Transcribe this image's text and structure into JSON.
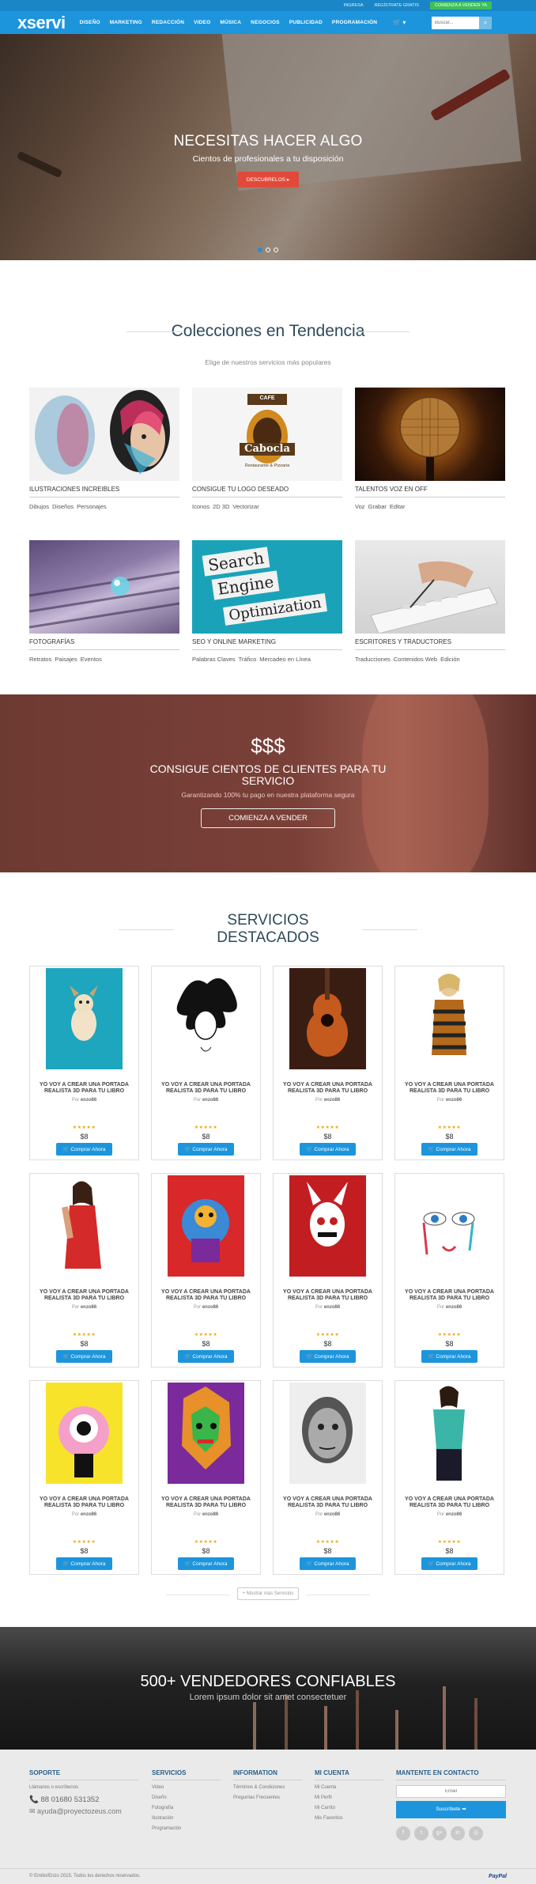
{
  "topbar": {
    "links": [
      "INGRESA",
      "REGÍSTRATE GRATIS"
    ],
    "sell": "COMIENZA A VENDER YA"
  },
  "nav": {
    "logo": "xservi",
    "links": [
      "DISEÑO",
      "MARKETING",
      "REDACCIÓN",
      "VIDEO",
      "MÚSICA",
      "NEGOCIOS",
      "PUBLICIDAD",
      "PROGRAMACIÓN"
    ],
    "cart": "🛒 ▾",
    "search_placeholder": "Buscar..."
  },
  "hero": {
    "title": "NECESITAS HACER ALGO",
    "subtitle": "Cientos de profesionales a tu disposición",
    "button": "DESCUBRELOS ▸"
  },
  "collections": {
    "title": "Colecciones en Tendencia",
    "subtitle": "Elige de nuestros servicios más populares",
    "items": [
      {
        "name": "ILUSTRACIONES INCREIBLES",
        "tags": [
          "Dibujos",
          "Diseños",
          "Personajes"
        ]
      },
      {
        "name": "CONSIGUE TU LOGO DESEADO",
        "tags": [
          "Iconos",
          "2D 3D",
          "Vectorizar"
        ]
      },
      {
        "name": "TALENTOS VOZ EN OFF",
        "tags": [
          "Voz",
          "Grabar",
          "Editar"
        ]
      },
      {
        "name": "FOTOGRAFÍAS",
        "tags": [
          "Retratos",
          "Paisajes",
          "Eventos"
        ]
      },
      {
        "name": "SEO Y ONLINE MARKETING",
        "tags": [
          "Palabras Claves",
          "Tráfico",
          "Mercadeo en Línea"
        ]
      },
      {
        "name": "ESCRITORES Y TRADUCTORES",
        "tags": [
          "Traducciones",
          "Contenidos Web",
          "Edición"
        ]
      }
    ],
    "logo_text": {
      "top": "CAFE",
      "name": "Cabocla",
      "tagline": "Restaurante & Pizzaria"
    },
    "seo_words": [
      "Search",
      "Engine",
      "Optimization"
    ]
  },
  "sell_banner": {
    "symbol": "$$$",
    "title": "CONSIGUE CIENTOS DE CLIENTES PARA TU SERVICIO",
    "subtitle": "Garantizando 100% tu pago en nuestra plataforma segura",
    "button": "COMIENZA A VENDER"
  },
  "featured": {
    "title_line1": "SERVICIOS",
    "title_line2": "DESTACADOS",
    "card_title": "YO VOY A CREAR UNA PORTADA REALISTA 3D PARA TU LIBRO",
    "by_label": "Por",
    "seller": "enzo86",
    "stars": "★★★★★",
    "price": "$8",
    "buy": "🛒 Comprar Ahora",
    "more": "+ Mostrar más Servicios"
  },
  "sellers": {
    "title": "500+ VENDEDORES CONFIABLES",
    "subtitle": "Lorem ipsum dolor sit amet consectetuer"
  },
  "footer": {
    "support": {
      "title": "SOPORTE",
      "label": "Llámanos o escríbenos",
      "phone": "📞 88 01680 531352",
      "email": "✉ ayuda@proyectozeus.com"
    },
    "services": {
      "title": "SERVICIOS",
      "items": [
        "Video",
        "Diseño",
        "Fotografía",
        "Ilustración",
        "Programación"
      ]
    },
    "information": {
      "title": "INFORMATION",
      "items": [
        "Términos & Condiciones",
        "Preguntas Frecuentes"
      ]
    },
    "account": {
      "title": "MI CUENTA",
      "items": [
        "Mi Cuenta",
        "Mi Perfil",
        "Mi Carrito",
        "Mis Favoritos"
      ]
    },
    "contact": {
      "title": "MANTENTE EN CONTACTO",
      "email_placeholder": "Email",
      "subscribe": "Suscríbete ➡"
    },
    "social": [
      "f",
      "t",
      "g+",
      "in",
      "◎"
    ],
    "copyright": "© Emilio/Enzo 2015. Todos los derechos reservados.",
    "paypal": "PayPal"
  }
}
